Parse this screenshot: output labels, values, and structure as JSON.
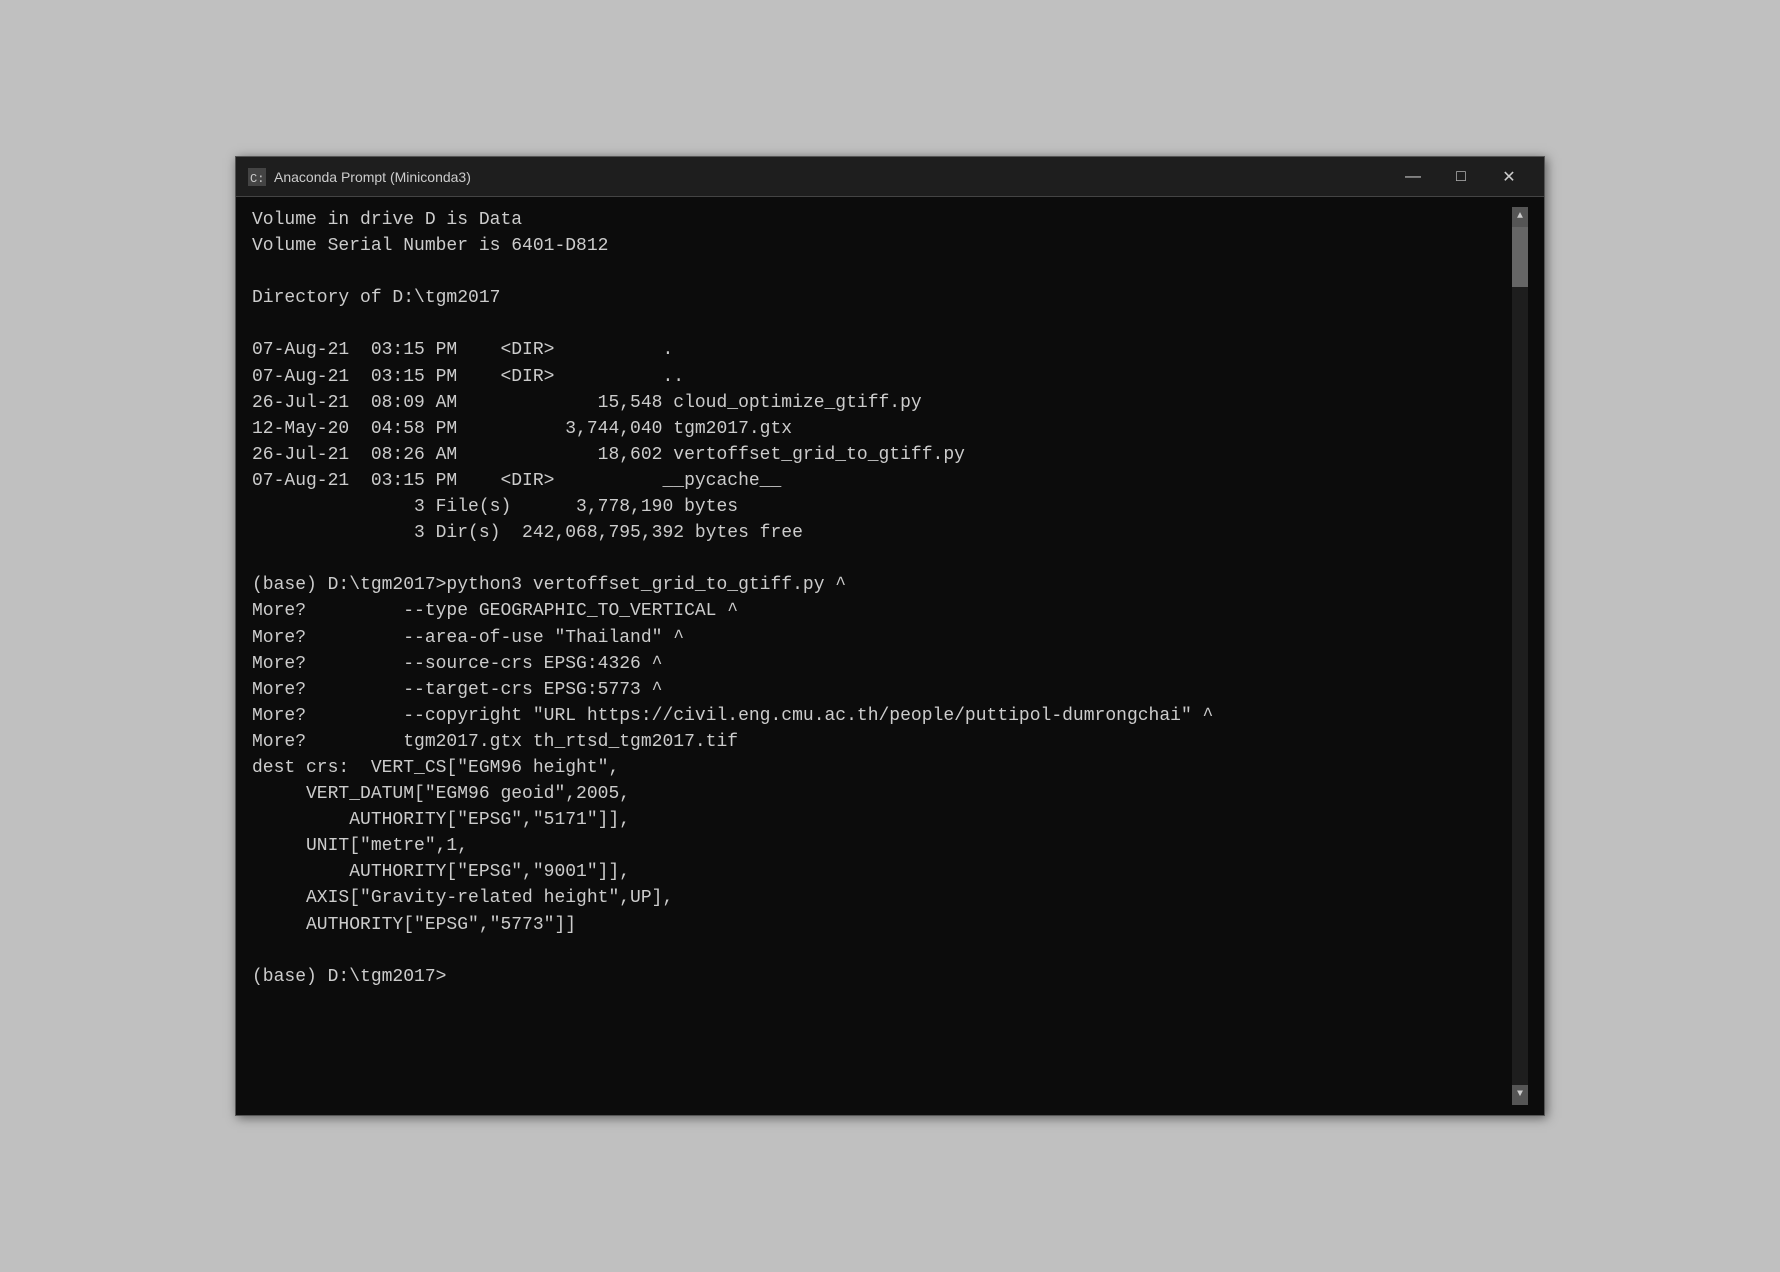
{
  "window": {
    "title": "Anaconda Prompt (Miniconda3)",
    "controls": {
      "minimize": "—",
      "maximize": "□",
      "close": "✕"
    }
  },
  "terminal": {
    "lines": [
      "Volume in drive D is Data",
      "Volume Serial Number is 6401-D812",
      "",
      "Directory of D:\\tgm2017",
      "",
      "07-Aug-21  03:15 PM    <DIR>          .",
      "07-Aug-21  03:15 PM    <DIR>          ..",
      "26-Jul-21  08:09 AM             15,548 cloud_optimize_gtiff.py",
      "12-May-20  04:58 PM          3,744,040 tgm2017.gtx",
      "26-Jul-21  08:26 AM             18,602 vertoffset_grid_to_gtiff.py",
      "07-Aug-21  03:15 PM    <DIR>          __pycache__",
      "               3 File(s)      3,778,190 bytes",
      "               3 Dir(s)  242,068,795,392 bytes free",
      "",
      "(base) D:\\tgm2017>python3 vertoffset_grid_to_gtiff.py ^",
      "More?         --type GEOGRAPHIC_TO_VERTICAL ^",
      "More?         --area-of-use \"Thailand\" ^",
      "More?         --source-crs EPSG:4326 ^",
      "More?         --target-crs EPSG:5773 ^",
      "More?         --copyright \"URL https://civil.eng.cmu.ac.th/people/puttipol-dumrongchai\" ^",
      "More?         tgm2017.gtx th_rtsd_tgm2017.tif",
      "dest crs:  VERT_CS[\"EGM96 height\",",
      "     VERT_DATUM[\"EGM96 geoid\",2005,",
      "         AUTHORITY[\"EPSG\",\"5171\"]],",
      "     UNIT[\"metre\",1,",
      "         AUTHORITY[\"EPSG\",\"9001\"]],",
      "     AXIS[\"Gravity-related height\",UP],",
      "     AUTHORITY[\"EPSG\",\"5773\"]]",
      "",
      "(base) D:\\tgm2017>"
    ]
  }
}
